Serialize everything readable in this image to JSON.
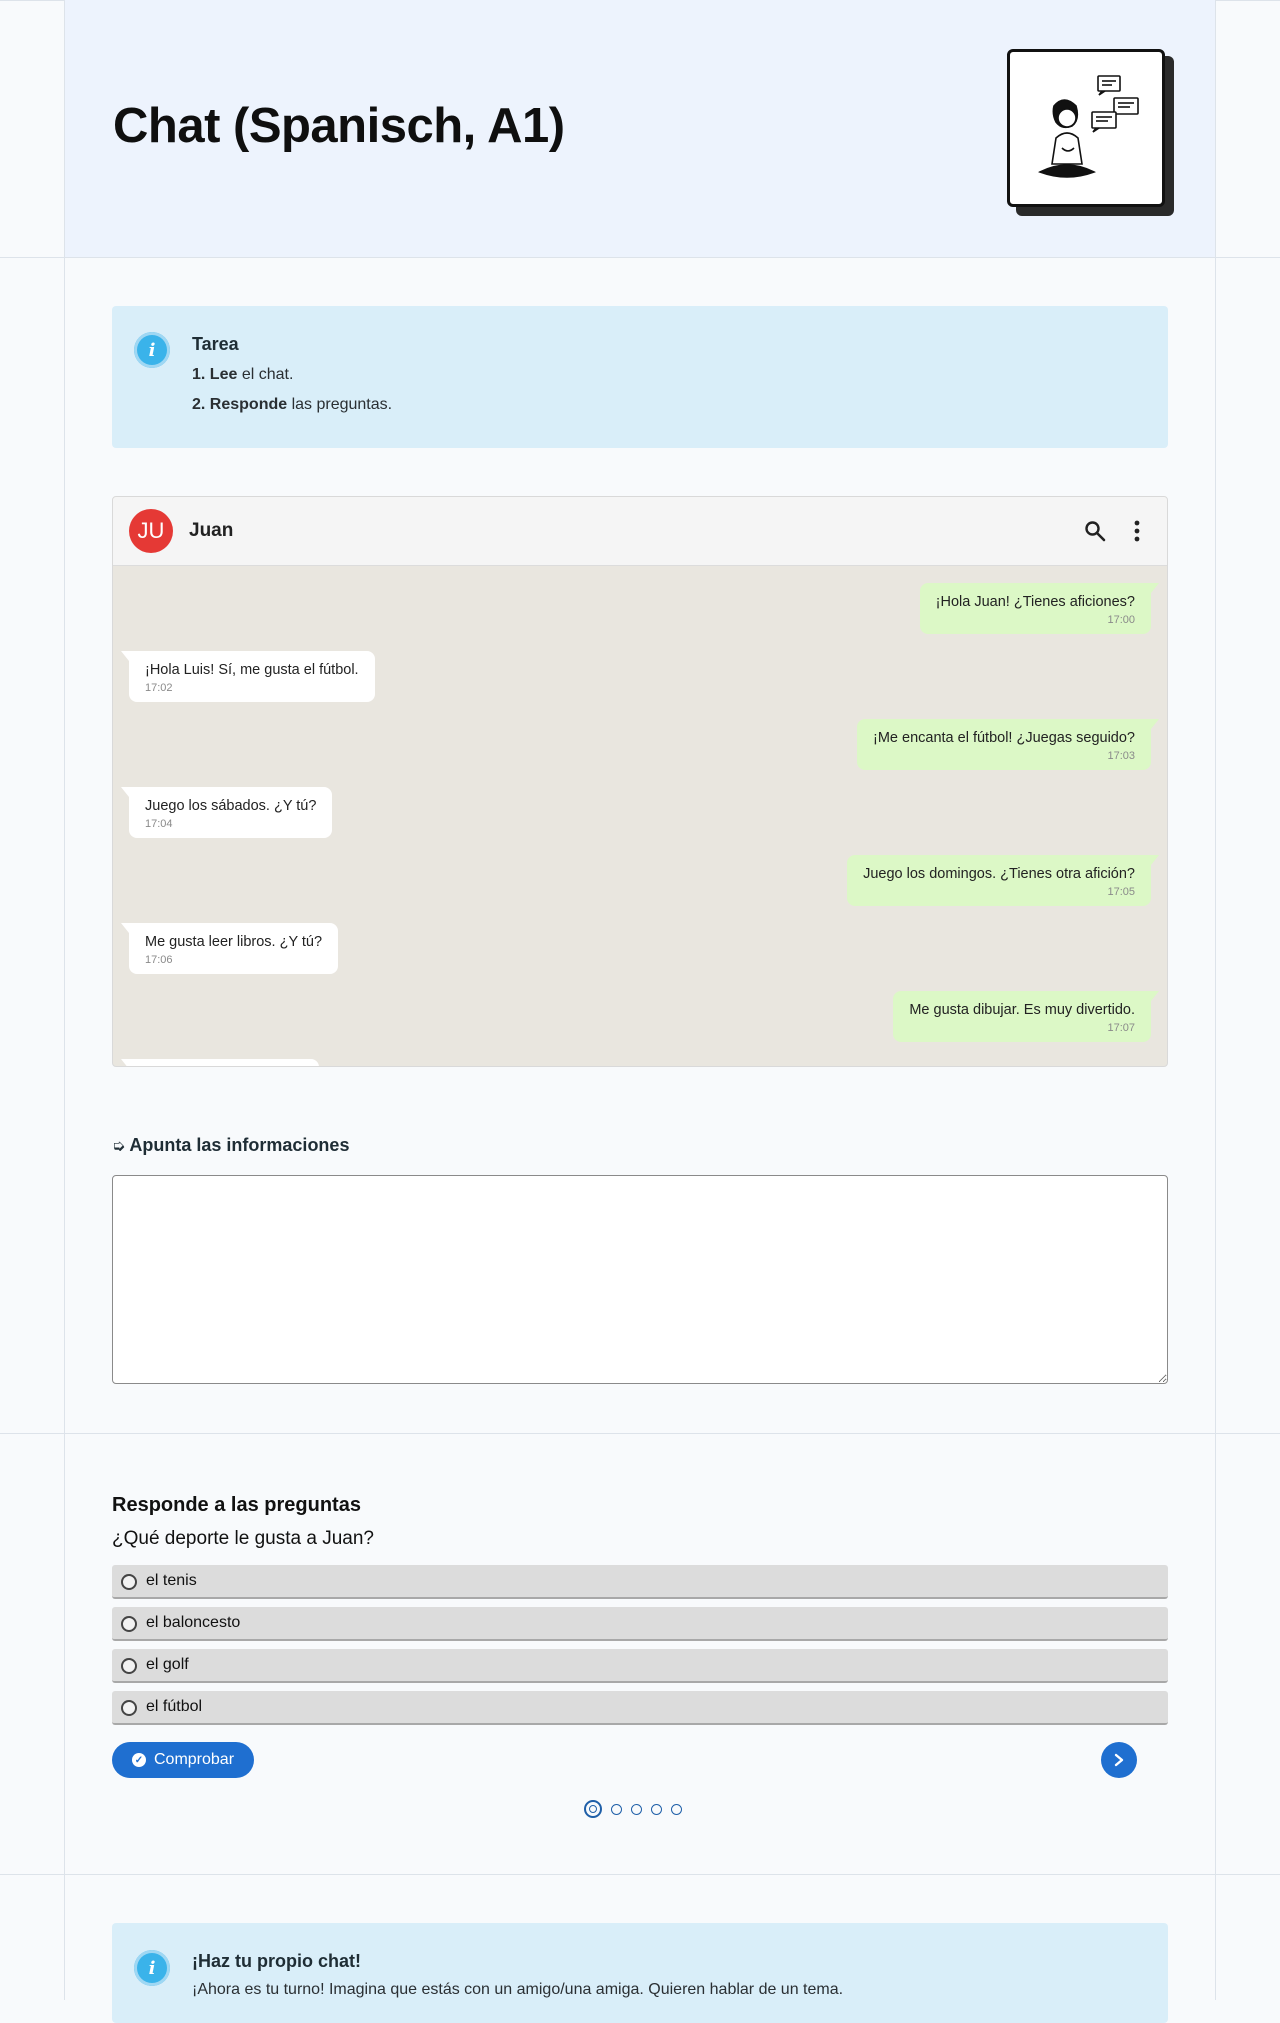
{
  "header": {
    "title": "Chat (Spanisch, A1)"
  },
  "task": {
    "title": "Tarea",
    "steps": [
      {
        "num": "1.",
        "bold": "Lee",
        "rest": " el chat."
      },
      {
        "num": "2.",
        "bold": "Responde",
        "rest": " las preguntas."
      }
    ]
  },
  "chat": {
    "avatar_initials": "JU",
    "contact_name": "Juan",
    "messages": [
      {
        "side": "sent",
        "text": "¡Hola Juan! ¿Tienes aficiones?",
        "time": "17:00"
      },
      {
        "side": "recv",
        "text": "¡Hola Luis! Sí, me gusta el fútbol.",
        "time": "17:02"
      },
      {
        "side": "sent",
        "text": "¡Me encanta el fútbol! ¿Juegas seguido?",
        "time": "17:03"
      },
      {
        "side": "recv",
        "text": "Juego los sábados. ¿Y tú?",
        "time": "17:04"
      },
      {
        "side": "sent",
        "text": "Juego los domingos. ¿Tienes otra afición?",
        "time": "17:05"
      },
      {
        "side": "recv",
        "text": "Me gusta leer libros. ¿Y tú?",
        "time": "17:06"
      },
      {
        "side": "sent",
        "text": "Me gusta dibujar. Es muy divertido.",
        "time": "17:07"
      }
    ]
  },
  "notes": {
    "label": "Apunta las informaciones",
    "value": ""
  },
  "quiz": {
    "title": "Responde a las preguntas",
    "question": "¿Qué deporte le gusta a Juan?",
    "options": [
      "el tenis",
      "el baloncesto",
      "el golf",
      "el fútbol"
    ],
    "check_label": "Comprobar",
    "total_questions": 5,
    "current_question": 1
  },
  "own_chat": {
    "title": "¡Haz tu propio chat!",
    "text": "¡Ahora es tu turno! Imagina que estás con un amigo/una amiga. Quieren hablar de un tema."
  },
  "colors": {
    "accent": "#1f6fd0",
    "info_bg": "#d9eef9",
    "sent_bubble": "#dcf8c6",
    "avatar": "#e53935"
  }
}
